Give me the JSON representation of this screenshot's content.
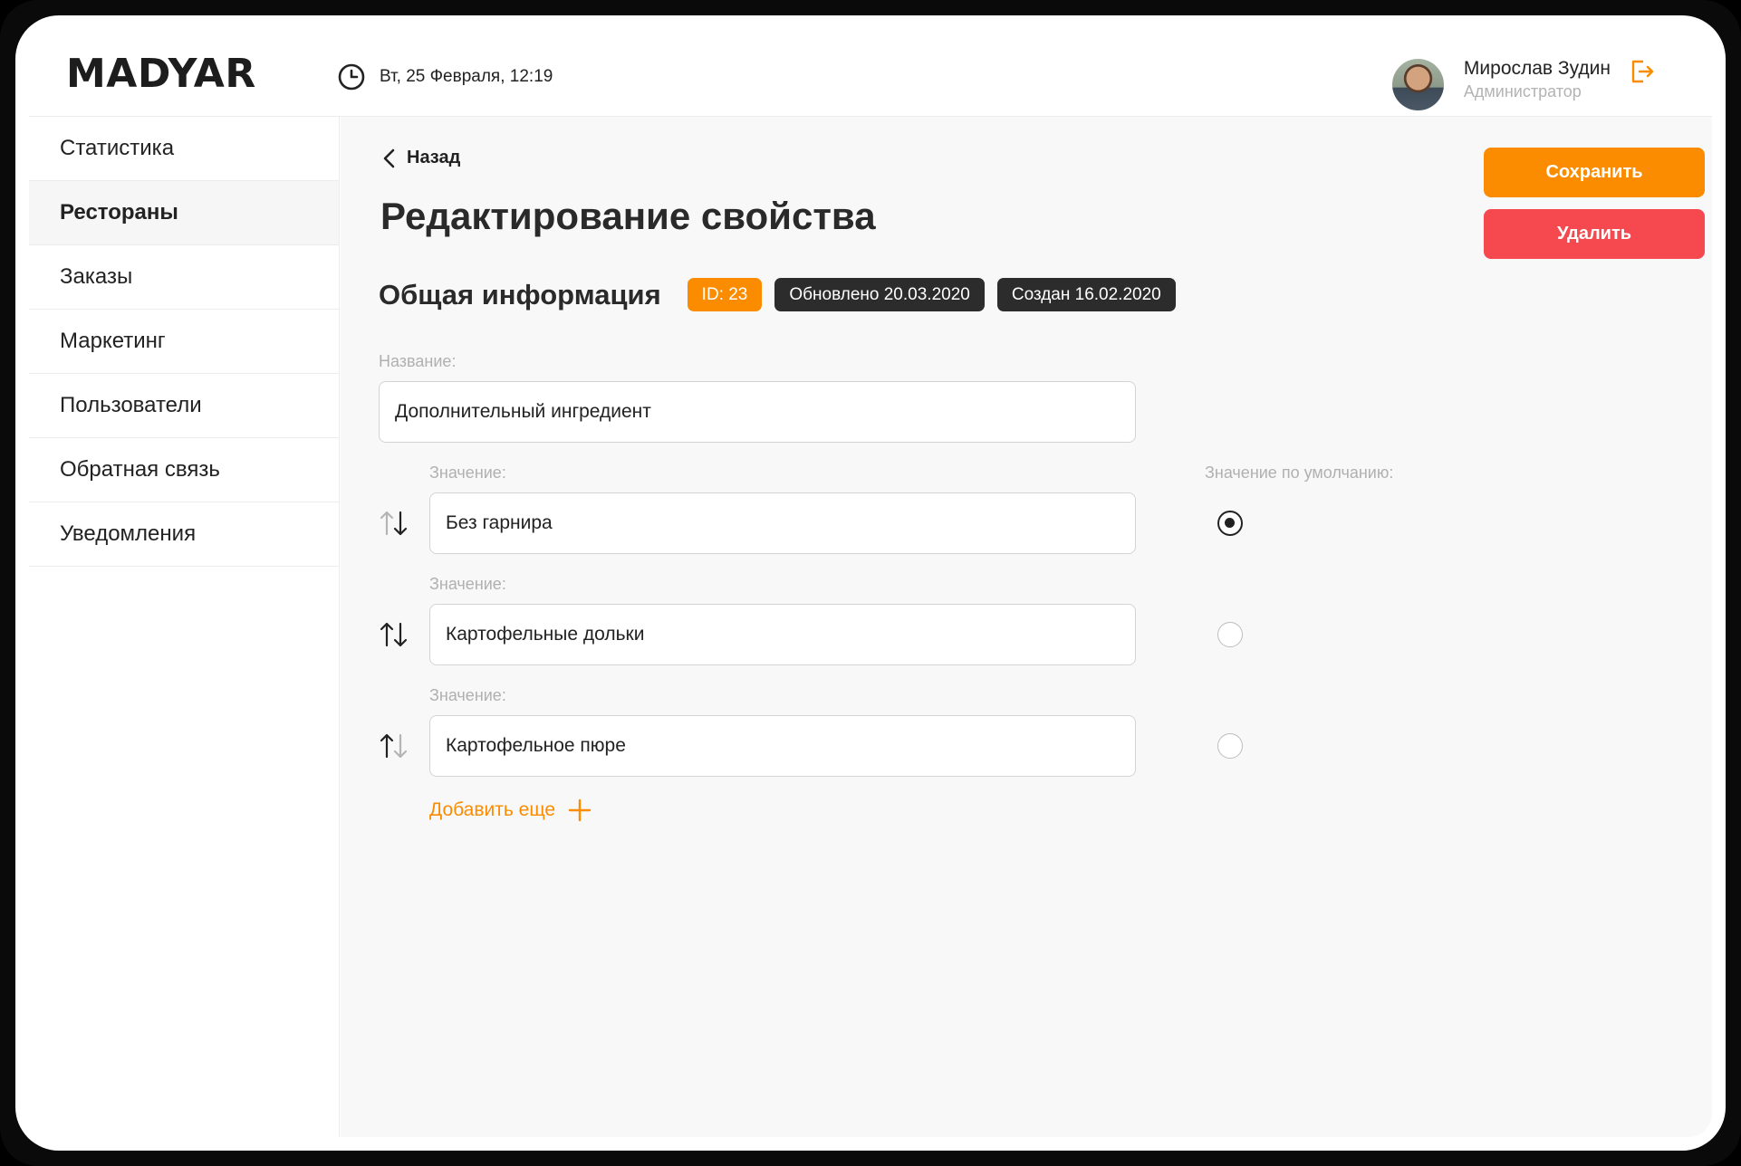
{
  "header": {
    "logo": "MADYAR",
    "datetime": "Вт, 25 Февраля, 12:19",
    "user_name": "Мирослав Зудин",
    "user_role": "Администратор"
  },
  "sidebar": {
    "items": [
      {
        "label": "Статистика",
        "active": false
      },
      {
        "label": "Рестораны",
        "active": true
      },
      {
        "label": "Заказы",
        "active": false
      },
      {
        "label": "Маркетинг",
        "active": false
      },
      {
        "label": "Пользователи",
        "active": false
      },
      {
        "label": "Обратная связь",
        "active": false
      },
      {
        "label": "Уведомления",
        "active": false
      }
    ]
  },
  "main": {
    "back_label": "Назад",
    "title": "Редактирование свойства",
    "save_label": "Сохранить",
    "delete_label": "Удалить",
    "section_title": "Общая информация",
    "badges": {
      "id": "ID: 23",
      "updated": "Обновлено 20.03.2020",
      "created": "Создан 16.02.2020"
    },
    "name_label": "Название:",
    "name_value": "Дополнительный ингредиент",
    "default_label": "Значение по умолчанию:",
    "values": [
      {
        "label": "Значение:",
        "value": "Без гарнира",
        "default": true
      },
      {
        "label": "Значение:",
        "value": "Картофельные дольки",
        "default": false
      },
      {
        "label": "Значение:",
        "value": "Картофельное пюре",
        "default": false
      }
    ],
    "add_more_label": "Добавить еще"
  },
  "colors": {
    "accent": "#fb8c00",
    "danger": "#f5484f",
    "badge_dark": "#2c2c2c"
  }
}
